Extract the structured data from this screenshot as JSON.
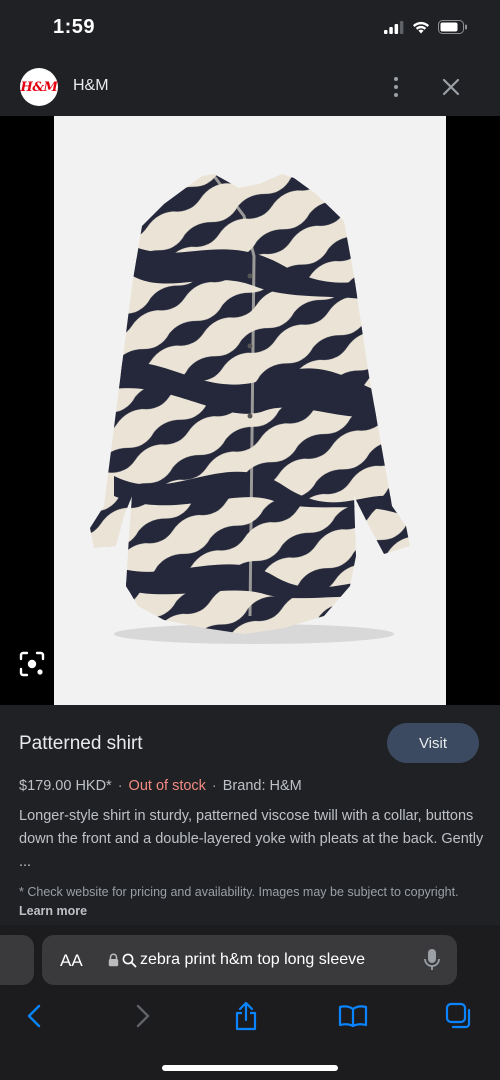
{
  "status_bar": {
    "time": "1:59"
  },
  "header": {
    "logo_text": "H&M",
    "site_name": "H&M"
  },
  "product": {
    "title": "Patterned shirt",
    "visit_label": "Visit",
    "price": "$179.00 HKD*",
    "separator": "·",
    "stock_status": "Out of stock",
    "brand": "Brand: H&M",
    "description": "Longer-style shirt in sturdy, patterned viscose twill with a collar, buttons down the front and a double-layered yoke with pleats at the back. Gently ...",
    "note": "* Check website for pricing and availability. Images may be subject to copyright.",
    "learn_more": "Learn more"
  },
  "browser": {
    "aa_label": "AA",
    "url_text": "zebra print h&m top long sleeve"
  },
  "colors": {
    "background": "#202124",
    "visit_button": "#3c4a61",
    "out_of_stock": "#f28b82",
    "accent_blue": "#0a84ff",
    "brand_red": "#e50010"
  },
  "icons": [
    "signal-icon",
    "wifi-icon",
    "battery-icon",
    "more-vert-icon",
    "close-icon",
    "lens-icon",
    "lock-icon",
    "search-icon",
    "mic-icon",
    "back-icon",
    "forward-icon",
    "share-icon",
    "bookmarks-icon",
    "tabs-icon"
  ]
}
